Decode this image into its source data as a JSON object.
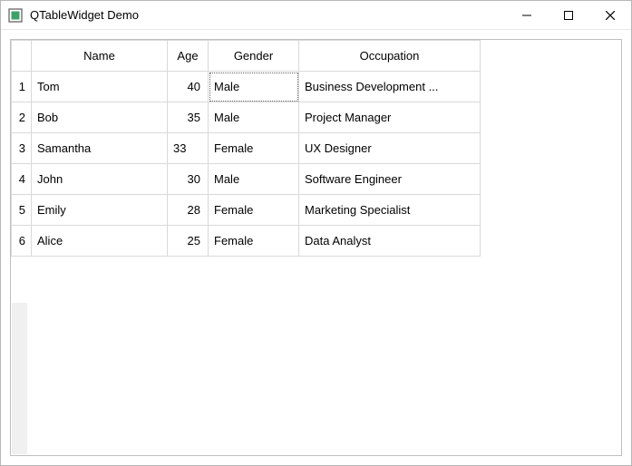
{
  "window": {
    "title": "QTableWidget Demo"
  },
  "table": {
    "headers": [
      "Name",
      "Age",
      "Gender",
      "Occupation"
    ],
    "row_numbers": [
      "1",
      "2",
      "3",
      "4",
      "5",
      "6"
    ],
    "rows": [
      {
        "name": "Tom",
        "age": "40",
        "age_align": "right",
        "gender": "Male",
        "occupation": "Business Development ..."
      },
      {
        "name": "Bob",
        "age": "35",
        "age_align": "right",
        "gender": "Male",
        "occupation": "Project Manager"
      },
      {
        "name": "Samantha",
        "age": "33",
        "age_align": "left",
        "gender": "Female",
        "occupation": "UX Designer"
      },
      {
        "name": "John",
        "age": "30",
        "age_align": "right",
        "gender": "Male",
        "occupation": "Software Engineer"
      },
      {
        "name": "Emily",
        "age": "28",
        "age_align": "right",
        "gender": "Female",
        "occupation": "Marketing Specialist"
      },
      {
        "name": "Alice",
        "age": "25",
        "age_align": "right",
        "gender": "Female",
        "occupation": "Data Analyst"
      }
    ],
    "focused_cell": {
      "row": 0,
      "col": 2
    }
  }
}
